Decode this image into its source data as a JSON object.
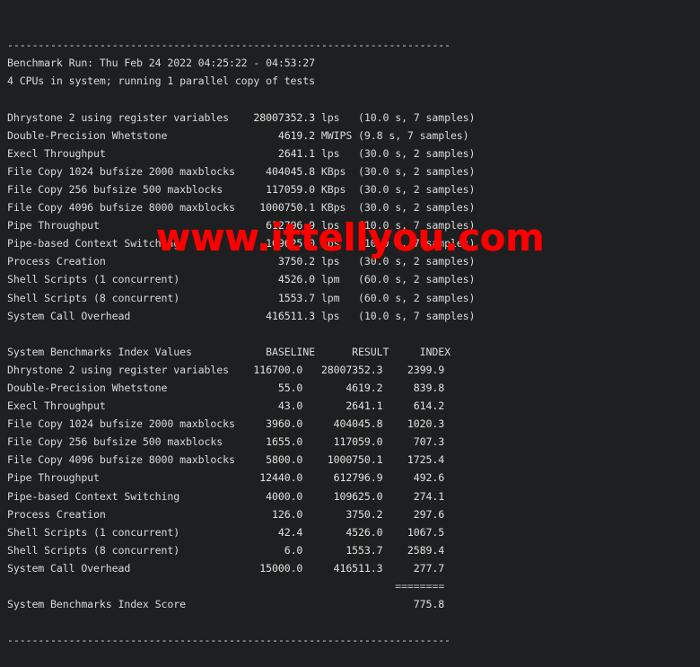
{
  "terminal": {
    "top_rule": "------------------------------------------------------------------------",
    "bottom_rule": "------------------------------------------------------------------------",
    "header": {
      "benchmark_run": "Benchmark Run: Thu Feb 24 2022 04:25:22 - 04:53:27",
      "cpu_line": "4 CPUs in system; running 1 parallel copy of tests"
    },
    "raw_results": [
      {
        "name": "Dhrystone 2 using register variables",
        "value": "28007352.3",
        "unit": "lps",
        "meta": "(10.0 s, 7 samples)"
      },
      {
        "name": "Double-Precision Whetstone",
        "value": "4619.2",
        "unit": "MWIPS",
        "meta": "(9.8 s, 7 samples)"
      },
      {
        "name": "Execl Throughput",
        "value": "2641.1",
        "unit": "lps",
        "meta": "(30.0 s, 2 samples)"
      },
      {
        "name": "File Copy 1024 bufsize 2000 maxblocks",
        "value": "404045.8",
        "unit": "KBps",
        "meta": "(30.0 s, 2 samples)"
      },
      {
        "name": "File Copy 256 bufsize 500 maxblocks",
        "value": "117059.0",
        "unit": "KBps",
        "meta": "(30.0 s, 2 samples)"
      },
      {
        "name": "File Copy 4096 bufsize 8000 maxblocks",
        "value": "1000750.1",
        "unit": "KBps",
        "meta": "(30.0 s, 2 samples)"
      },
      {
        "name": "Pipe Throughput",
        "value": "612796.9",
        "unit": "lps",
        "meta": "(10.0 s, 7 samples)"
      },
      {
        "name": "Pipe-based Context Switching",
        "value": "109625.0",
        "unit": "lps",
        "meta": "(10.0 s, 7 samples)"
      },
      {
        "name": "Process Creation",
        "value": "3750.2",
        "unit": "lps",
        "meta": "(30.0 s, 2 samples)"
      },
      {
        "name": "Shell Scripts (1 concurrent)",
        "value": "4526.0",
        "unit": "lpm",
        "meta": "(60.0 s, 2 samples)"
      },
      {
        "name": "Shell Scripts (8 concurrent)",
        "value": "1553.7",
        "unit": "lpm",
        "meta": "(60.0 s, 2 samples)"
      },
      {
        "name": "System Call Overhead",
        "value": "416511.3",
        "unit": "lps",
        "meta": "(10.0 s, 7 samples)"
      }
    ],
    "index_table": {
      "title": "System Benchmarks Index Values",
      "columns": [
        "BASELINE",
        "RESULT",
        "INDEX"
      ],
      "rows": [
        {
          "name": "Dhrystone 2 using register variables",
          "baseline": "116700.0",
          "result": "28007352.3",
          "index": "2399.9"
        },
        {
          "name": "Double-Precision Whetstone",
          "baseline": "55.0",
          "result": "4619.2",
          "index": "839.8"
        },
        {
          "name": "Execl Throughput",
          "baseline": "43.0",
          "result": "2641.1",
          "index": "614.2"
        },
        {
          "name": "File Copy 1024 bufsize 2000 maxblocks",
          "baseline": "3960.0",
          "result": "404045.8",
          "index": "1020.3"
        },
        {
          "name": "File Copy 256 bufsize 500 maxblocks",
          "baseline": "1655.0",
          "result": "117059.0",
          "index": "707.3"
        },
        {
          "name": "File Copy 4096 bufsize 8000 maxblocks",
          "baseline": "5800.0",
          "result": "1000750.1",
          "index": "1725.4"
        },
        {
          "name": "Pipe Throughput",
          "baseline": "12440.0",
          "result": "612796.9",
          "index": "492.6"
        },
        {
          "name": "Pipe-based Context Switching",
          "baseline": "4000.0",
          "result": "109625.0",
          "index": "274.1"
        },
        {
          "name": "Process Creation",
          "baseline": "126.0",
          "result": "3750.2",
          "index": "297.6"
        },
        {
          "name": "Shell Scripts (1 concurrent)",
          "baseline": "42.4",
          "result": "4526.0",
          "index": "1067.5"
        },
        {
          "name": "Shell Scripts (8 concurrent)",
          "baseline": "6.0",
          "result": "1553.7",
          "index": "2589.4"
        },
        {
          "name": "System Call Overhead",
          "baseline": "15000.0",
          "result": "416511.3",
          "index": "277.7"
        }
      ],
      "separator": "========",
      "score_label": "System Benchmarks Index Score",
      "score_value": "775.8"
    }
  },
  "watermark": {
    "text": "www.ittellyou.com",
    "color": "#fc0000"
  }
}
